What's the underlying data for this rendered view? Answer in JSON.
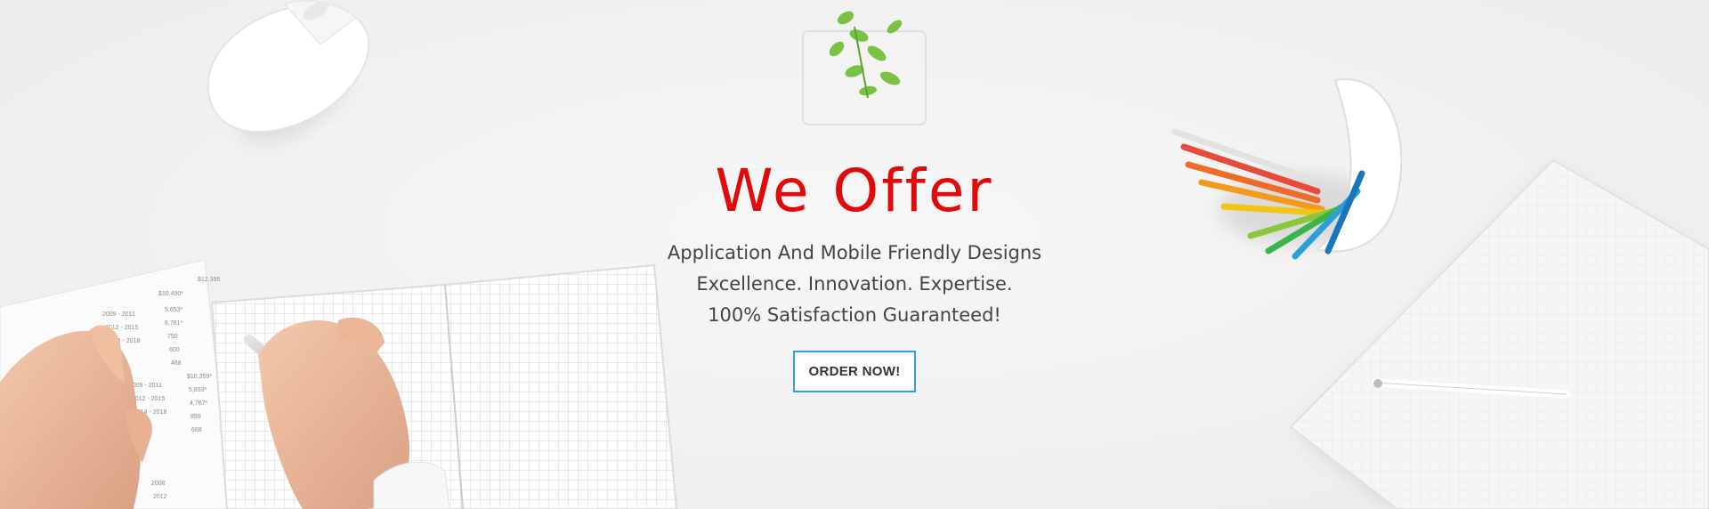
{
  "hero": {
    "title": "We Offer",
    "taglines": [
      "Application And Mobile Friendly Designs",
      "Excellence. Innovation. Expertise.",
      "100% Satisfaction Guaranteed!"
    ],
    "cta_label": "ORDER NOW!"
  },
  "colors": {
    "title": "#e10a0a",
    "cta_border": "#29a3e0",
    "text": "#444444",
    "background": "#f2f2f2"
  },
  "decor": [
    "computer-mouse",
    "plant-in-glass",
    "pencil-cup",
    "notepad-with-pen",
    "open-notebook",
    "writing-hand",
    "hand",
    "printed-report"
  ]
}
